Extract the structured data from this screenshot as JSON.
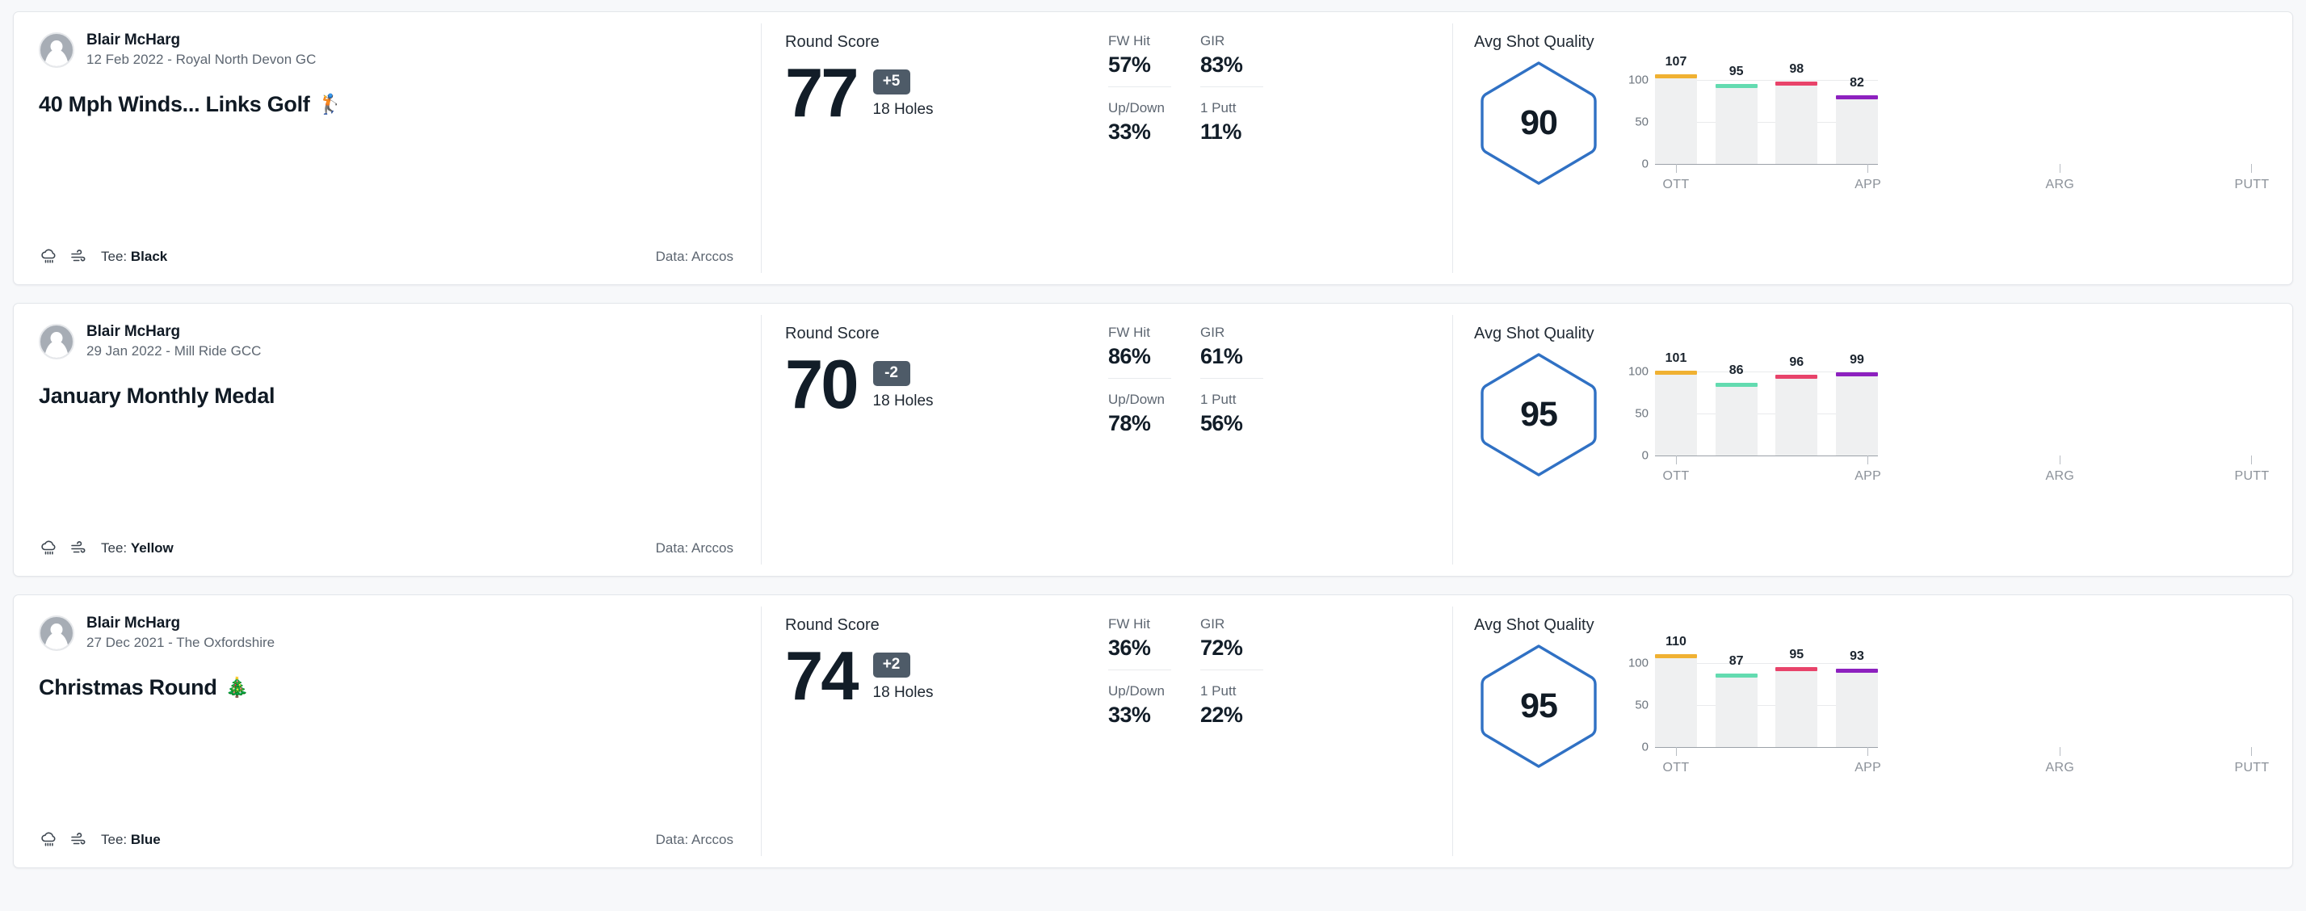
{
  "labels": {
    "round_score": "Round Score",
    "holes": "18 Holes",
    "avg_shot_quality": "Avg Shot Quality",
    "tee_prefix": "Tee: ",
    "data_prefix": "Data: ",
    "stat_fw": "FW Hit",
    "stat_gir": "GIR",
    "stat_updown": "Up/Down",
    "stat_1putt": "1 Putt"
  },
  "colors": {
    "ott": "#f0b132",
    "app": "#63dbb0",
    "arg": "#e8436a",
    "putt": "#8d21bf",
    "hexagon": "#3071c4",
    "badge": "#4e5b68",
    "bar_body": "#eff0f1"
  },
  "rounds": [
    {
      "player": "Blair McHarg",
      "meta": "12 Feb 2022 - Royal North Devon GC",
      "title": "40 Mph Winds... Links Golf",
      "emoji": "🏌️",
      "tee": "Black",
      "data_source": "Arccos",
      "score": "77",
      "par_diff": "+5",
      "holes": "18 Holes",
      "stats": {
        "fw_hit": "57%",
        "gir": "83%",
        "up_down": "33%",
        "one_putt": "11%"
      },
      "shot_quality": "90",
      "chart_data": {
        "type": "bar",
        "title": "Avg Shot Quality",
        "categories": [
          "OTT",
          "APP",
          "ARG",
          "PUTT"
        ],
        "values": [
          107,
          95,
          98,
          82
        ],
        "colors": [
          "#f0b132",
          "#63dbb0",
          "#e8436a",
          "#8d21bf"
        ],
        "yticks": [
          0,
          50,
          100
        ],
        "ylim": [
          0,
          120
        ],
        "xlabel": "",
        "ylabel": "",
        "grid": true,
        "legend": "none"
      }
    },
    {
      "player": "Blair McHarg",
      "meta": "29 Jan 2022 - Mill Ride GCC",
      "title": "January Monthly Medal",
      "emoji": "",
      "tee": "Yellow",
      "data_source": "Arccos",
      "score": "70",
      "par_diff": "-2",
      "holes": "18 Holes",
      "stats": {
        "fw_hit": "86%",
        "gir": "61%",
        "up_down": "78%",
        "one_putt": "56%"
      },
      "shot_quality": "95",
      "chart_data": {
        "type": "bar",
        "title": "Avg Shot Quality",
        "categories": [
          "OTT",
          "APP",
          "ARG",
          "PUTT"
        ],
        "values": [
          101,
          86,
          96,
          99
        ],
        "colors": [
          "#f0b132",
          "#63dbb0",
          "#e8436a",
          "#8d21bf"
        ],
        "yticks": [
          0,
          50,
          100
        ],
        "ylim": [
          0,
          120
        ],
        "xlabel": "",
        "ylabel": "",
        "grid": true,
        "legend": "none"
      }
    },
    {
      "player": "Blair McHarg",
      "meta": "27 Dec 2021 - The Oxfordshire",
      "title": "Christmas Round",
      "emoji": "🎄",
      "tee": "Blue",
      "data_source": "Arccos",
      "score": "74",
      "par_diff": "+2",
      "holes": "18 Holes",
      "stats": {
        "fw_hit": "36%",
        "gir": "72%",
        "up_down": "33%",
        "one_putt": "22%"
      },
      "shot_quality": "95",
      "chart_data": {
        "type": "bar",
        "title": "Avg Shot Quality",
        "categories": [
          "OTT",
          "APP",
          "ARG",
          "PUTT"
        ],
        "values": [
          110,
          87,
          95,
          93
        ],
        "colors": [
          "#f0b132",
          "#63dbb0",
          "#e8436a",
          "#8d21bf"
        ],
        "yticks": [
          0,
          50,
          100
        ],
        "ylim": [
          0,
          120
        ],
        "xlabel": "",
        "ylabel": "",
        "grid": true,
        "legend": "none"
      }
    }
  ]
}
